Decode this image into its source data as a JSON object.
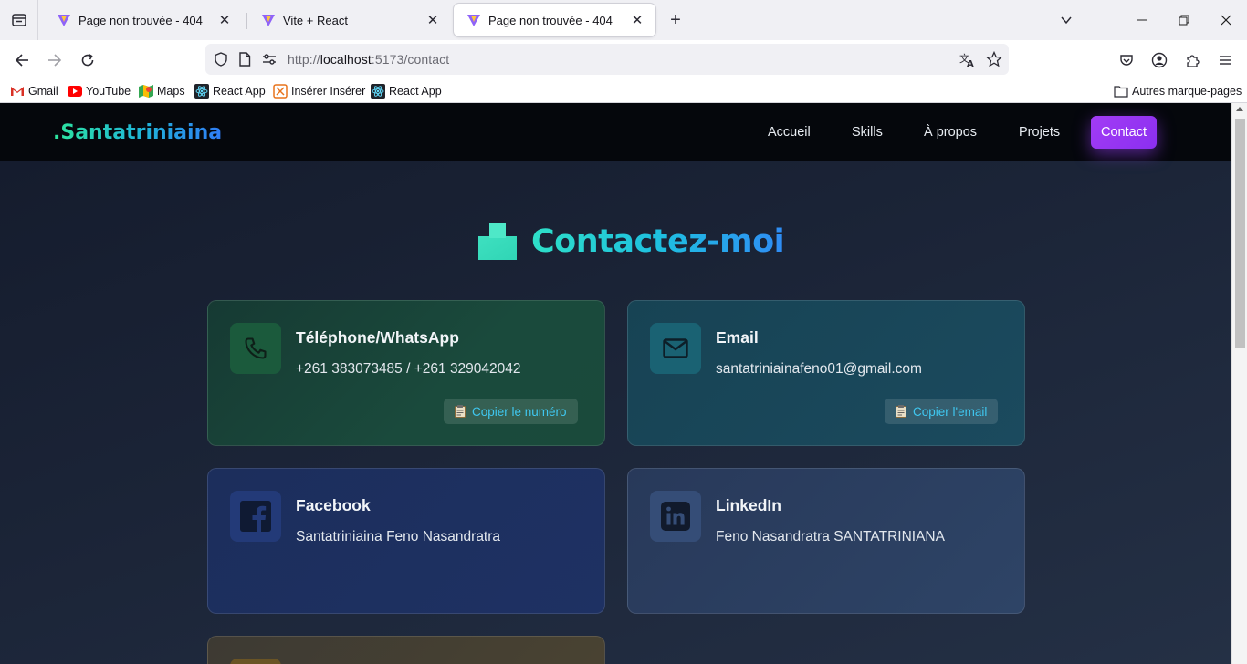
{
  "browser": {
    "tabs": [
      {
        "title": "Page non trouvée - 404",
        "active": false
      },
      {
        "title": "Vite + React",
        "active": false
      },
      {
        "title": "Page non trouvée - 404",
        "active": true
      }
    ],
    "url": {
      "prefix": "http://",
      "host": "localhost",
      "rest": ":5173/contact"
    },
    "bookmarks": [
      {
        "label": "Gmail",
        "icon": "gmail-icon"
      },
      {
        "label": "YouTube",
        "icon": "youtube-icon"
      },
      {
        "label": "Maps",
        "icon": "maps-icon"
      },
      {
        "label": "React App",
        "icon": "react-icon"
      },
      {
        "label": "Insérer Insérer",
        "icon": "insert-icon"
      },
      {
        "label": "React App",
        "icon": "react-icon"
      }
    ],
    "other_bookmarks": "Autres marque-pages"
  },
  "site": {
    "logo": ".Santatriniaina",
    "menu": [
      "Accueil",
      "Skills",
      "À propos",
      "Projets",
      "Contact"
    ],
    "active_menu": "Contact",
    "heading": "Contactez-moi",
    "cards": {
      "phone": {
        "title": "Téléphone/WhatsApp",
        "value": "+261 383073485 / +261 329042042",
        "button": "Copier le numéro",
        "icon": "phone-icon"
      },
      "email": {
        "title": "Email",
        "value": "santatriniainafeno01@gmail.com",
        "button": "Copier l'email",
        "icon": "mail-icon"
      },
      "facebook": {
        "title": "Facebook",
        "value": "Santatriniaina Feno Nasandratra",
        "icon": "facebook-icon"
      },
      "linkedin": {
        "title": "LinkedIn",
        "value": "Feno Nasandratra SANTATRINIANA",
        "icon": "linkedin-icon"
      }
    }
  },
  "colors": {
    "accent_purple": "#a23cf5",
    "logo_gradient_start": "#2ee59d",
    "logo_gradient_end": "#2f7cf6",
    "copy_text": "#3fc7f0"
  }
}
